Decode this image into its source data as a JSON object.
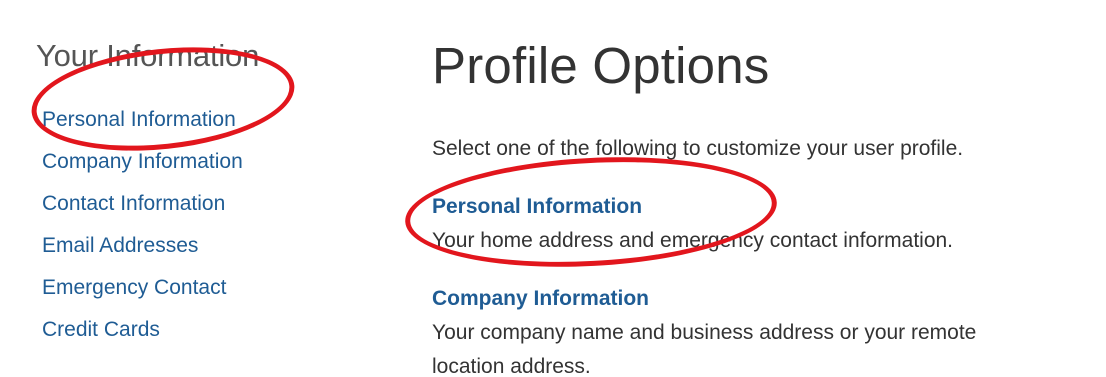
{
  "sidebar": {
    "heading": "Your Information",
    "items": [
      {
        "label": "Personal Information"
      },
      {
        "label": "Company Information"
      },
      {
        "label": "Contact Information"
      },
      {
        "label": "Email Addresses"
      },
      {
        "label": "Emergency Contact"
      },
      {
        "label": "Credit Cards"
      }
    ]
  },
  "main": {
    "title": "Profile Options",
    "intro": "Select one of the following to customize your user profile.",
    "options": [
      {
        "title": "Personal Information",
        "description": "Your home address and emergency contact information."
      },
      {
        "title": "Company Information",
        "description_line1": "Your company name and business address or your remote",
        "description_line2": "location address."
      }
    ]
  },
  "annotations": {
    "color": "#e2161d"
  },
  "colors": {
    "link": "#1f5c94",
    "text": "#333333",
    "heading": "#555555"
  }
}
